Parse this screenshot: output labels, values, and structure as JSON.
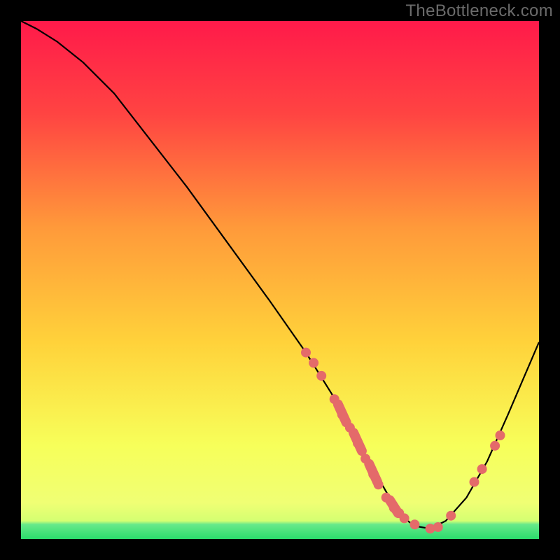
{
  "watermark": "TheBottleneck.com",
  "colors": {
    "bg": "#000000",
    "gradient_top": "#ff1a4a",
    "gradient_upper": "#ff5a3c",
    "gradient_mid": "#ffd23a",
    "gradient_lower": "#f7ff5a",
    "gradient_bottom_yellow": "#f0ff74",
    "green_band": "#2bdc6c",
    "curve": "#000000",
    "dot_fill": "#e46a6a",
    "dot_stroke": "#c94f4f"
  },
  "chart_data": {
    "type": "line",
    "title": "",
    "xlabel": "",
    "ylabel": "",
    "xlim": [
      0,
      100
    ],
    "ylim": [
      0,
      100
    ],
    "series": [
      {
        "name": "bottleneck-curve",
        "x": [
          0,
          3,
          7,
          12,
          18,
          25,
          32,
          40,
          48,
          55,
          60,
          64,
          67,
          70,
          72,
          74,
          76,
          79,
          82,
          86,
          90,
          94,
          97,
          100
        ],
        "y": [
          100,
          98.5,
          96,
          92,
          86,
          77,
          68,
          57,
          46,
          36,
          28,
          21,
          15,
          10,
          6.5,
          4,
          2.5,
          2,
          3.5,
          8,
          15,
          24,
          31,
          38
        ]
      }
    ],
    "dots": [
      {
        "x": 55,
        "y": 36
      },
      {
        "x": 56.5,
        "y": 34
      },
      {
        "x": 58,
        "y": 31.5
      },
      {
        "x": 60.5,
        "y": 27
      },
      {
        "x": 62,
        "y": 24
      },
      {
        "x": 63.5,
        "y": 21.5
      },
      {
        "x": 65,
        "y": 18.5
      },
      {
        "x": 66.5,
        "y": 15.5
      },
      {
        "x": 68,
        "y": 12.5
      },
      {
        "x": 69,
        "y": 10.5
      },
      {
        "x": 70.5,
        "y": 8
      },
      {
        "x": 72,
        "y": 6
      },
      {
        "x": 73,
        "y": 5
      },
      {
        "x": 74,
        "y": 4
      },
      {
        "x": 76,
        "y": 2.8
      },
      {
        "x": 79,
        "y": 2
      },
      {
        "x": 80.5,
        "y": 2.3
      },
      {
        "x": 83,
        "y": 4.5
      },
      {
        "x": 87.5,
        "y": 11
      },
      {
        "x": 89,
        "y": 13.5
      },
      {
        "x": 91.5,
        "y": 18
      },
      {
        "x": 92.5,
        "y": 20
      }
    ],
    "long_dots": [
      {
        "x": 61.2,
        "y1": 26,
        "y2": 22.5
      },
      {
        "x": 64.2,
        "y1": 20.5,
        "y2": 17
      },
      {
        "x": 67.2,
        "y1": 14.5,
        "y2": 11
      },
      {
        "x": 71.2,
        "y1": 7.5,
        "y2": 5
      }
    ]
  }
}
